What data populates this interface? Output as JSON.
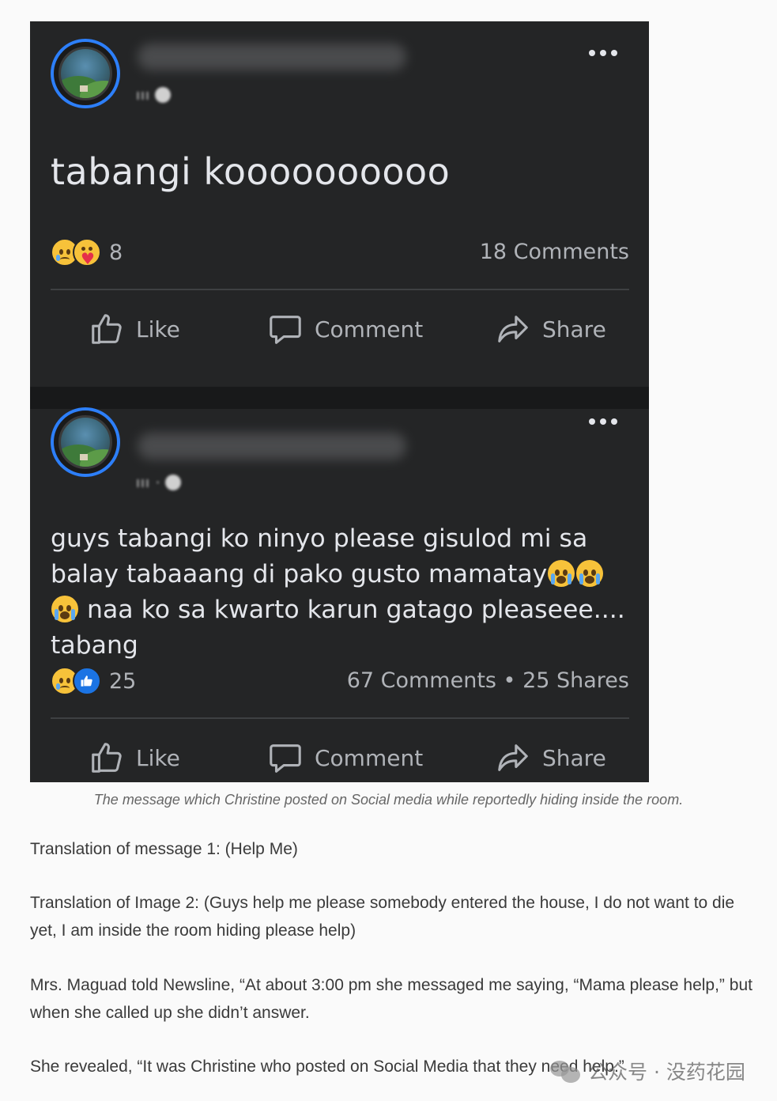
{
  "post1": {
    "text": "tabangi koooooooooo",
    "reaction_count": "8",
    "counts": "18 Comments",
    "actions": {
      "like": "Like",
      "comment": "Comment",
      "share": "Share"
    }
  },
  "post2": {
    "text_line1": "guys tabangi ko ninyo please gisulod mi sa",
    "text_line2": "balay tabaaang di pako gusto mamatay",
    "text_line3": " naa ko sa kwarto karun gatago pleaseee....",
    "text_line4": "tabang",
    "reaction_count": "25",
    "counts": "67 Comments • 25 Shares",
    "actions": {
      "like": "Like",
      "comment": "Comment",
      "share": "Share"
    }
  },
  "caption": "The message which Christine posted on Social media while reportedly hiding inside the room.",
  "paragraphs": {
    "p1": "Translation of message 1: (Help Me)",
    "p2": "Translation of Image 2: (Guys help me please somebody entered the house, I do not want to die yet, I am inside the room hiding please help)",
    "p3": "Mrs. Maguad told Newsline, “At about 3:00 pm she messaged me saying, “Mama please help,” but when she called up she didn’t answer.",
    "p4": "She revealed, “It was Christine who posted on Social Media that they need help.”"
  },
  "watermark": "公众号 · 没药花园",
  "colors": {
    "card_bg": "#242526",
    "band_bg": "#18191a",
    "text": "#e4e6eb",
    "muted": "#b0b3b8",
    "avatar_ring": "#2d7ff9",
    "like_blue": "#1b74e4"
  },
  "icons": [
    "more-icon",
    "like-icon",
    "comment-icon",
    "share-icon",
    "crying-emoji",
    "sad-reaction",
    "care-reaction",
    "like-reaction"
  ]
}
